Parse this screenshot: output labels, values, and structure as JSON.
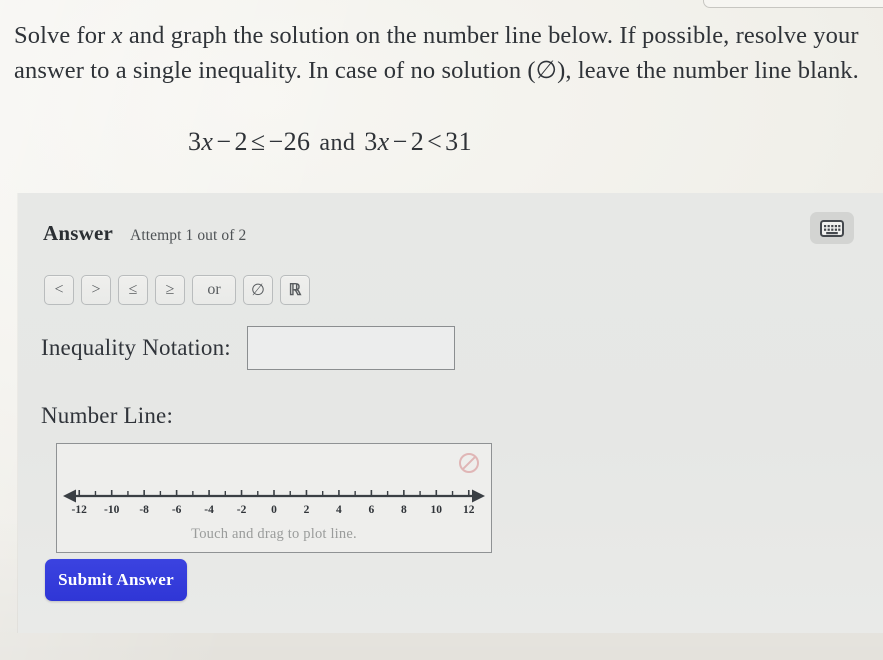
{
  "question": {
    "line1_a": "Solve for ",
    "line1_var": "x",
    "line1_b": " and graph the solution on the number line below. If possible, resolve your answer to a single inequality. In case of no solution (∅), leave the number line blank."
  },
  "equation": {
    "left_coef": "3",
    "left_var": "x",
    "left_minus": "−",
    "left_const": "2",
    "left_rel": "≤",
    "left_rhs": "−26",
    "conjunction": "and",
    "right_coef": "3",
    "right_var": "x",
    "right_minus": "−",
    "right_const": "2",
    "right_rel": "<",
    "right_rhs": "31"
  },
  "answer": {
    "title": "Answer",
    "attempt": "Attempt 1 out of 2",
    "keyboard_icon": "keyboard-icon",
    "operators": [
      {
        "label": "<",
        "name": "less-than",
        "wide": false
      },
      {
        "label": ">",
        "name": "greater-than",
        "wide": false
      },
      {
        "label": "≤",
        "name": "less-than-or-equal",
        "wide": false
      },
      {
        "label": "≥",
        "name": "greater-than-or-equal",
        "wide": false
      },
      {
        "label": "or",
        "name": "or",
        "wide": true
      },
      {
        "label": "∅",
        "name": "empty-set",
        "wide": false
      },
      {
        "label": "ℝ",
        "name": "real-numbers",
        "wide": false
      }
    ],
    "inequality_label": "Inequality Notation:",
    "inequality_value": "",
    "inequality_placeholder": "",
    "number_line_label": "Number Line:",
    "number_line_hint": "Touch and drag to plot line.",
    "clear_icon": "no-entry-icon",
    "submit_label": "Submit Answer"
  },
  "chart_data": {
    "type": "number-line",
    "title": "Number Line:",
    "xlim": [
      -13,
      13
    ],
    "major_ticks": [
      -12,
      -10,
      -8,
      -6,
      -4,
      -2,
      0,
      2,
      4,
      6,
      8,
      10,
      12
    ],
    "tick_labels": [
      "-12",
      "-10",
      "-8",
      "-6",
      "-4",
      "-2",
      "0",
      "2",
      "4",
      "6",
      "8",
      "10",
      "12"
    ],
    "minor_ticks": [
      -11,
      -9,
      -7,
      -5,
      -3,
      -1,
      1,
      3,
      5,
      7,
      9,
      11
    ],
    "arrows": "both",
    "plotted_points": [],
    "plotted_rays": [],
    "grid": false,
    "hint": "Touch and drag to plot line."
  },
  "colors": {
    "page_bg": "#f1f0ea",
    "panel_bg": "#e7e8e6",
    "accent_blue": "#3b43e0",
    "clear_red": "#e3b3b3",
    "text": "#2f3338",
    "muted": "#9a9c9b",
    "border": "#8f9294"
  }
}
